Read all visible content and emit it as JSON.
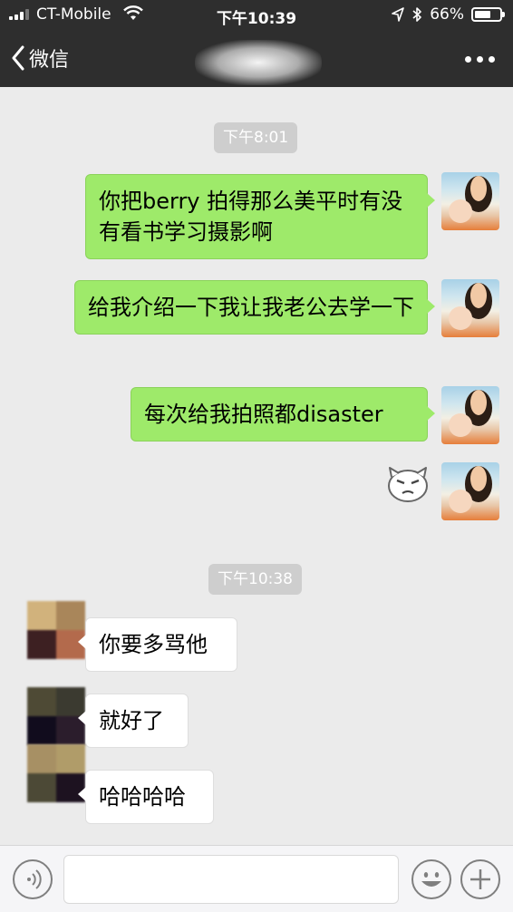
{
  "status_bar": {
    "carrier": "CT-Mobile",
    "time": "下午10:39",
    "battery": "66%",
    "battery_level": 0.66
  },
  "nav": {
    "back_label": "微信"
  },
  "messages": {
    "time1": "下午8:01",
    "m1": "你把berry 拍得那么美平时有没有看书学习摄影啊",
    "m2": "给我介绍一下我让我老公去学一下",
    "m3": "每次给我拍照都disaster",
    "time2": "下午10:38",
    "r1": "你要多骂他",
    "r2": "就好了",
    "r3": "哈哈哈哈"
  },
  "icons": {
    "signal": "signal-icon",
    "wifi": "wifi-icon",
    "location": "location-arrow-icon",
    "bluetooth": "bluetooth-icon",
    "battery": "battery-icon",
    "back": "chevron-left-icon",
    "more": "more-dots-icon",
    "voice": "voice-icon",
    "emoji": "emoji-icon",
    "add": "plus-icon"
  },
  "colors": {
    "header": "#2e2e2e",
    "chat_bg": "#ebebeb",
    "sent_bubble": "#9eea6a",
    "received_bubble": "#ffffff"
  }
}
